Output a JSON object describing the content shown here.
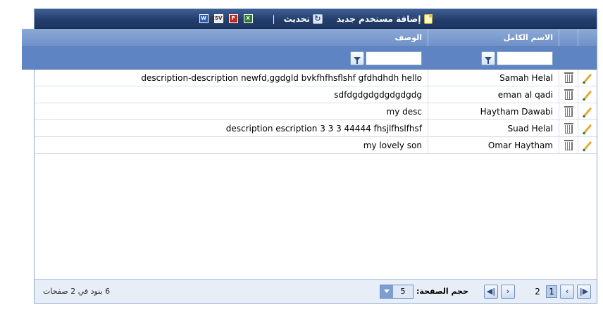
{
  "toolbar": {
    "add_user_label": "إضافة مستخدم جديد",
    "refresh_label": "تحديث",
    "separator": "|",
    "exports": [
      "word",
      "csv",
      "pdf",
      "excel"
    ]
  },
  "columns": {
    "full_name": "الاسم الكامل",
    "description": "الوصف"
  },
  "filters": {
    "full_name_value": "",
    "description_value": ""
  },
  "rows": [
    {
      "name": "Samah Helal",
      "description": "description-description newfd,ggdgld bvkfhfhsflshf gfdhdhdh hello"
    },
    {
      "name": "eman al qadi",
      "description": "sdfdgdgdgdgdgdgdg"
    },
    {
      "name": "Haytham Dawabi",
      "description": "my desc"
    },
    {
      "name": "Suad Helal",
      "description": "description escription 3 3 3 44444 fhsjlfhslfhsf"
    },
    {
      "name": "Omar Haytham",
      "description": "my lovely son"
    }
  ],
  "pager": {
    "pages": [
      "1",
      "2"
    ],
    "current_page": "1",
    "page_size_label": "حجم الصفحة:",
    "page_size_value": "5",
    "info": "6 بنود في 2 صفحات"
  },
  "colors": {
    "toolbar": "#233e6c",
    "header": "#7b9ccf",
    "filter_row": "#5f84c3",
    "pager_bg": "#e8eef7"
  }
}
